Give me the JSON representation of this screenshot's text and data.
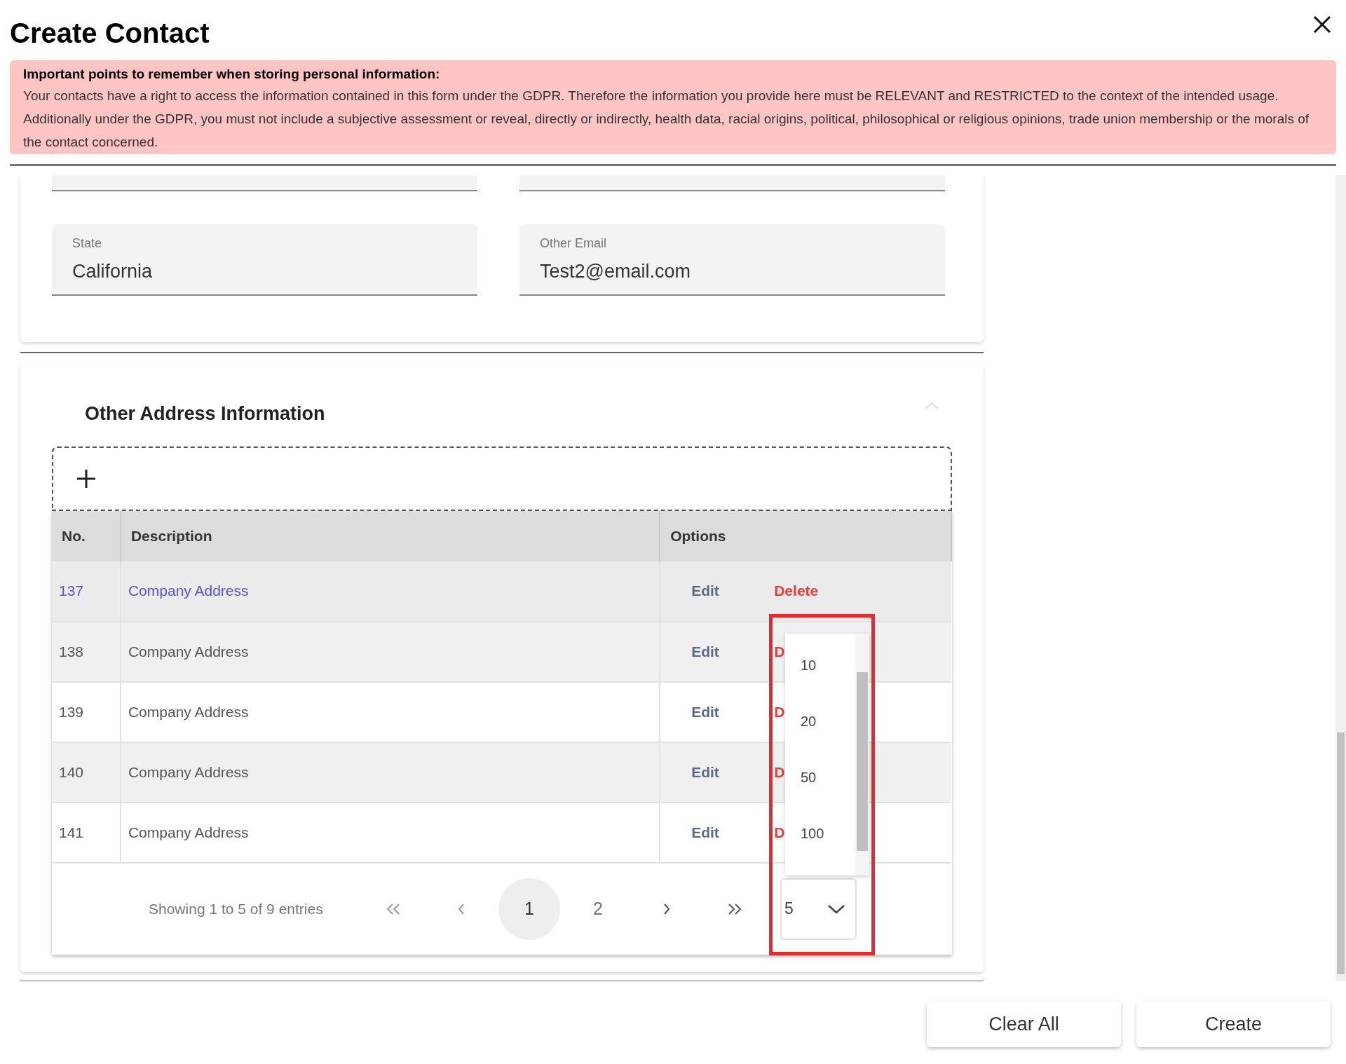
{
  "dialog": {
    "title": "Create Contact"
  },
  "notice": {
    "heading": "Important points to remember when storing personal information:",
    "text": "Your contacts have a right to access the information contained in this form under the GDPR. Therefore the information you provide here must be RELEVANT and RESTRICTED to the context of the intended usage. Additionally under the GDPR, you must not include a subjective assessment or reveal, directly or indirectly, health data, racial origins, political, philosophical or religious opinions, trade union membership or the morals of the contact concerned."
  },
  "contact_fields": [
    {
      "label": "State",
      "value": "California"
    },
    {
      "label": "Other Email",
      "value": "Test2@email.com"
    }
  ],
  "other_address": {
    "title": "Other Address Information",
    "expanded": true,
    "table": {
      "columns": [
        "No.",
        "Description",
        "Options"
      ],
      "rows": [
        {
          "no": "137",
          "description": "Company Address",
          "edit": "Edit",
          "delete": "Delete",
          "selected": true
        },
        {
          "no": "138",
          "description": "Company Address",
          "edit": "Edit",
          "delete": "D",
          "selected": false
        },
        {
          "no": "139",
          "description": "Company Address",
          "edit": "Edit",
          "delete": "D",
          "selected": false
        },
        {
          "no": "140",
          "description": "Company Address",
          "edit": "Edit",
          "delete": "D",
          "selected": false
        },
        {
          "no": "141",
          "description": "Company Address",
          "edit": "Edit",
          "delete": "D",
          "selected": false
        }
      ]
    },
    "pagination": {
      "summary": "Showing 1 to 5 of 9 entries",
      "pages": [
        {
          "label": "1",
          "selected": true
        },
        {
          "label": "2",
          "selected": false
        }
      ],
      "page_size": {
        "value": "5",
        "open": true,
        "options": [
          "10",
          "20",
          "50",
          "100"
        ]
      }
    }
  },
  "buttons": [
    "Clear All",
    "Create"
  ]
}
